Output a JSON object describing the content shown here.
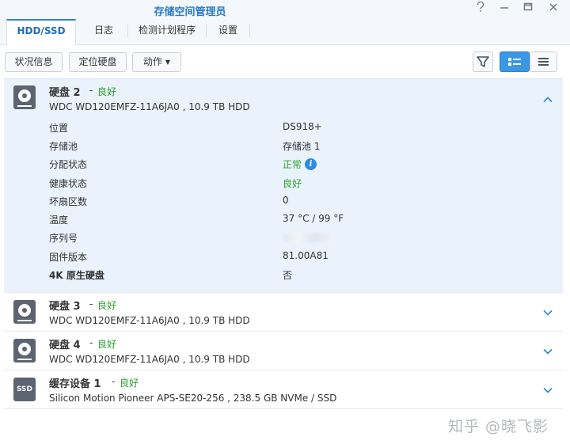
{
  "window": {
    "title": "存储空间管理员",
    "controls": [
      "help-icon",
      "minimize-icon",
      "maximize-icon",
      "close-icon"
    ]
  },
  "tabs": [
    {
      "label": "HDD/SSD",
      "active": true
    },
    {
      "label": "日志",
      "active": false
    },
    {
      "label": "检测计划程序",
      "active": false
    },
    {
      "label": "设置",
      "active": false
    }
  ],
  "toolbar": {
    "status_info": "状况信息",
    "locate_disk": "定位硬盘",
    "action": "动作",
    "filter_icon": "filter-icon",
    "view_detail_icon": "list-detail-icon",
    "view_list_icon": "list-compact-icon"
  },
  "colors": {
    "accent": "#2b86d4",
    "good": "#2ca02c",
    "expanded_bg": "#eaf3fb"
  },
  "disks": [
    {
      "name": "硬盘 2",
      "sep": "-",
      "status": "良好",
      "model": "WDC WD120EMFZ-11A6JA0 , 10.9 TB HDD",
      "icon": "hdd-icon",
      "expanded": true,
      "details": [
        {
          "label": "位置",
          "value": "DS918+"
        },
        {
          "label": "存储池",
          "value": "存储池 1"
        },
        {
          "label": "分配状态",
          "value": "正常"
        },
        {
          "label": "健康状态",
          "value": "良好"
        },
        {
          "label": "坏扇区数",
          "value": "0"
        },
        {
          "label": "温度",
          "value": "37 °C / 99 °F"
        },
        {
          "label": "序列号",
          "value": ""
        },
        {
          "label": "固件版本",
          "value": "81.00A81"
        },
        {
          "label": "4K 原生硬盘",
          "value": "否"
        }
      ]
    },
    {
      "name": "硬盘 3",
      "sep": "-",
      "status": "良好",
      "model": "WDC WD120EMFZ-11A6JA0 , 10.9 TB HDD",
      "icon": "hdd-icon",
      "expanded": false
    },
    {
      "name": "硬盘 4",
      "sep": "-",
      "status": "良好",
      "model": "WDC WD120EMFZ-11A6JA0 , 10.9 TB HDD",
      "icon": "hdd-icon",
      "expanded": false
    },
    {
      "name": "缓存设备 1",
      "sep": "-",
      "status": "良好",
      "model": "Silicon Motion Pioneer APS-SE20-256 , 238.5 GB NVMe / SSD",
      "icon": "ssd-icon",
      "icon_label": "SSD",
      "expanded": false
    }
  ],
  "watermark": "知乎 @晓飞影"
}
